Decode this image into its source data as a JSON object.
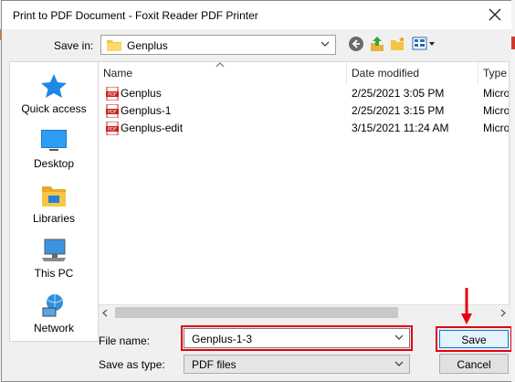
{
  "window": {
    "title": "Print to PDF Document - Foxit Reader PDF Printer"
  },
  "save_in": {
    "label": "Save in:",
    "value": "Genplus"
  },
  "toolbar": {
    "icons": [
      "back-icon",
      "up-folder-icon",
      "new-folder-icon",
      "view-menu-icon"
    ]
  },
  "places": [
    {
      "label": "Quick access",
      "icon": "star-icon"
    },
    {
      "label": "Desktop",
      "icon": "desktop-icon"
    },
    {
      "label": "Libraries",
      "icon": "libraries-icon"
    },
    {
      "label": "This PC",
      "icon": "computer-icon"
    },
    {
      "label": "Network",
      "icon": "network-icon"
    }
  ],
  "file_list": {
    "columns": [
      "Name",
      "Date modified",
      "Type"
    ],
    "rows": [
      {
        "name": "Genplus",
        "date": "2/25/2021 3:05 PM",
        "type": "Micro"
      },
      {
        "name": "Genplus-1",
        "date": "2/25/2021 3:15 PM",
        "type": "Micro"
      },
      {
        "name": "Genplus-edit",
        "date": "3/15/2021 11:24 AM",
        "type": "Micro"
      }
    ]
  },
  "file_name": {
    "label": "File name:",
    "value": "Genplus-1-3"
  },
  "save_as_type": {
    "label": "Save as type:",
    "value": "PDF files"
  },
  "buttons": {
    "save": "Save",
    "cancel": "Cancel"
  },
  "colors": {
    "highlight": "#e4000f",
    "accent": "#0078d7",
    "pdf": "#c8201a"
  }
}
